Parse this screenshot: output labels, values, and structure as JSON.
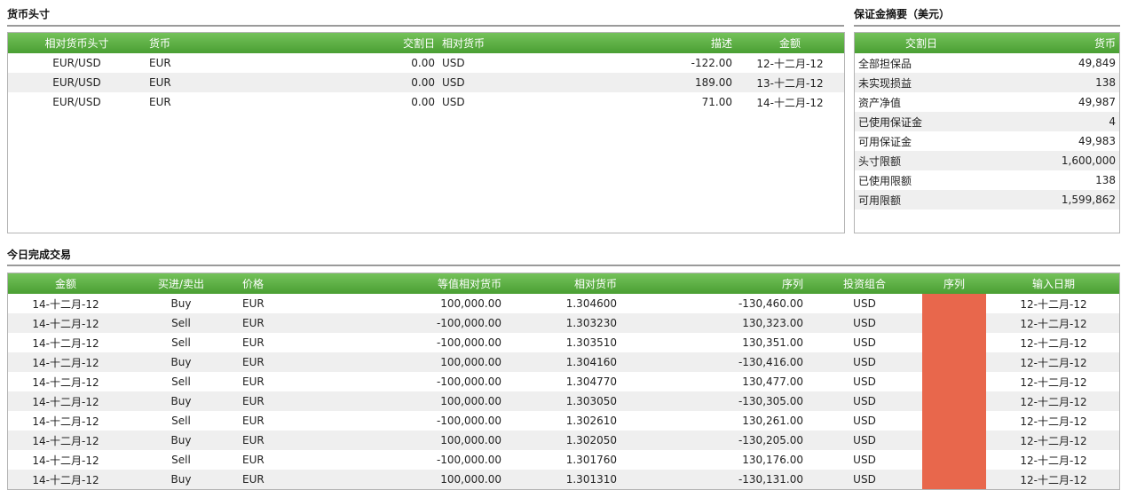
{
  "positions": {
    "title": "货币头寸",
    "headers": [
      "相对货币头寸",
      "货币",
      "交割日",
      "相对货币",
      "描述",
      "金额"
    ],
    "rows": [
      [
        "EUR/USD",
        "EUR",
        "0.00",
        "USD",
        "-122.00",
        "12-十二月-12"
      ],
      [
        "EUR/USD",
        "EUR",
        "0.00",
        "USD",
        "189.00",
        "13-十二月-12"
      ],
      [
        "EUR/USD",
        "EUR",
        "0.00",
        "USD",
        "71.00",
        "14-十二月-12"
      ]
    ]
  },
  "margin": {
    "title": "保证金摘要（美元）",
    "headers": [
      "交割日",
      "货币"
    ],
    "rows": [
      [
        "全部担保品",
        "49,849"
      ],
      [
        "未实现损益",
        "138"
      ],
      [
        "资产净值",
        "49,987"
      ],
      [
        "已使用保证金",
        "4"
      ],
      [
        "可用保证金",
        "49,983"
      ],
      [
        "头寸限额",
        "1,600,000"
      ],
      [
        "已使用限额",
        "138"
      ],
      [
        "可用限额",
        "1,599,862"
      ]
    ]
  },
  "trades": {
    "title": "今日完成交易",
    "headers": [
      "金额",
      "买进/卖出",
      "价格",
      "等值相对货币",
      "相对货币",
      "序列",
      "投资组合",
      "序列",
      "输入日期"
    ],
    "highlight_color": "#e8674c",
    "rows": [
      [
        "14-十二月-12",
        "Buy",
        "EUR",
        "100,000.00",
        "1.304600",
        "-130,460.00",
        "USD",
        "",
        "12-十二月-12"
      ],
      [
        "14-十二月-12",
        "Sell",
        "EUR",
        "-100,000.00",
        "1.303230",
        "130,323.00",
        "USD",
        "",
        "12-十二月-12"
      ],
      [
        "14-十二月-12",
        "Sell",
        "EUR",
        "-100,000.00",
        "1.303510",
        "130,351.00",
        "USD",
        "",
        "12-十二月-12"
      ],
      [
        "14-十二月-12",
        "Buy",
        "EUR",
        "100,000.00",
        "1.304160",
        "-130,416.00",
        "USD",
        "",
        "12-十二月-12"
      ],
      [
        "14-十二月-12",
        "Sell",
        "EUR",
        "-100,000.00",
        "1.304770",
        "130,477.00",
        "USD",
        "",
        "12-十二月-12"
      ],
      [
        "14-十二月-12",
        "Buy",
        "EUR",
        "100,000.00",
        "1.303050",
        "-130,305.00",
        "USD",
        "",
        "12-十二月-12"
      ],
      [
        "14-十二月-12",
        "Sell",
        "EUR",
        "-100,000.00",
        "1.302610",
        "130,261.00",
        "USD",
        "",
        "12-十二月-12"
      ],
      [
        "14-十二月-12",
        "Buy",
        "EUR",
        "100,000.00",
        "1.302050",
        "-130,205.00",
        "USD",
        "",
        "12-十二月-12"
      ],
      [
        "14-十二月-12",
        "Sell",
        "EUR",
        "-100,000.00",
        "1.301760",
        "130,176.00",
        "USD",
        "",
        "12-十二月-12"
      ],
      [
        "14-十二月-12",
        "Buy",
        "EUR",
        "100,000.00",
        "1.301310",
        "-130,131.00",
        "USD",
        "",
        "12-十二月-12"
      ]
    ]
  }
}
